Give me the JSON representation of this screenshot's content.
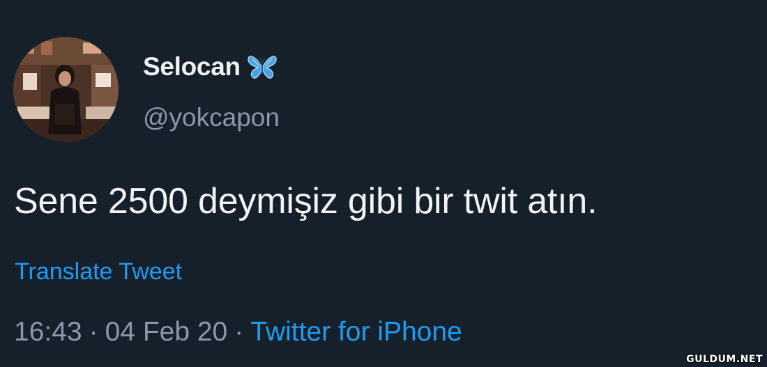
{
  "user": {
    "display_name": "Selocan",
    "handle": "@yokcapon",
    "badge_icon": "butterfly-emoji",
    "avatar_icon": "profile-photo"
  },
  "tweet": {
    "text": "Sene 2500 deymişiz gibi bir twit atın.",
    "translate_label": "Translate Tweet"
  },
  "meta": {
    "time": "16:43",
    "separator": "·",
    "date": "04 Feb 20",
    "source": "Twitter for iPhone"
  },
  "watermark": "GULDUM.NET",
  "colors": {
    "background": "#16202b",
    "link": "#1d9bf0",
    "secondary_text": "#8b98a5",
    "primary_text": "#f1f3f5"
  }
}
